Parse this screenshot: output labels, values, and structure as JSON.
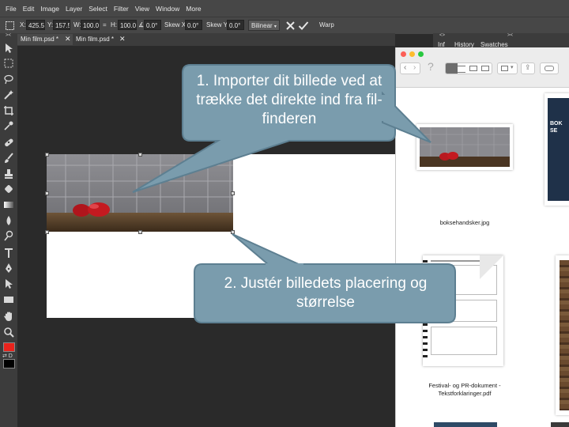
{
  "menu": [
    "File",
    "Edit",
    "Image",
    "Layer",
    "Select",
    "Filter",
    "View",
    "Window",
    "More"
  ],
  "options": {
    "x_label": "X:",
    "x_value": "425.5",
    "y_label": "Y:",
    "y_value": "157.5",
    "w_label": "W:",
    "w_value": "100.0!",
    "link_symbol": "=",
    "h_label": "H:",
    "h_value": "100.0!",
    "angle_label": "∡:",
    "angle_value": "0.0°",
    "skewx_label": "Skew X:",
    "skewx_value": "0.0°",
    "skewy_label": "Skew Y:",
    "skewy_value": "0.0°",
    "interpolation": "Bilinear",
    "warp_label": "Warp"
  },
  "tabs": [
    {
      "label": "Min film.psd *",
      "close": "✕"
    },
    {
      "label": "Min film.psd *",
      "close": "✕"
    }
  ],
  "right_panel": {
    "tabs": [
      "Inf",
      "History",
      "Swatches"
    ],
    "collapse_left": "<>",
    "collapse_right": "><"
  },
  "finder": {
    "help": "?",
    "files": [
      {
        "name": "boksehandsker.jpg"
      },
      {
        "name": "Festival- og PR-dokument - Tekstforklaringer.pdf"
      }
    ],
    "book_cover_text": "BOK SE"
  },
  "callouts": [
    {
      "text": "1. Importer dit billede ved at trække det direkte ind fra fil-finderen"
    },
    {
      "text": "2. Justér billedets placering og størrelse"
    }
  ],
  "colors": {
    "foreground": "#e8231c",
    "background": "#000000",
    "callout_fill": "#7a9cad",
    "callout_border": "#5d7f91"
  }
}
